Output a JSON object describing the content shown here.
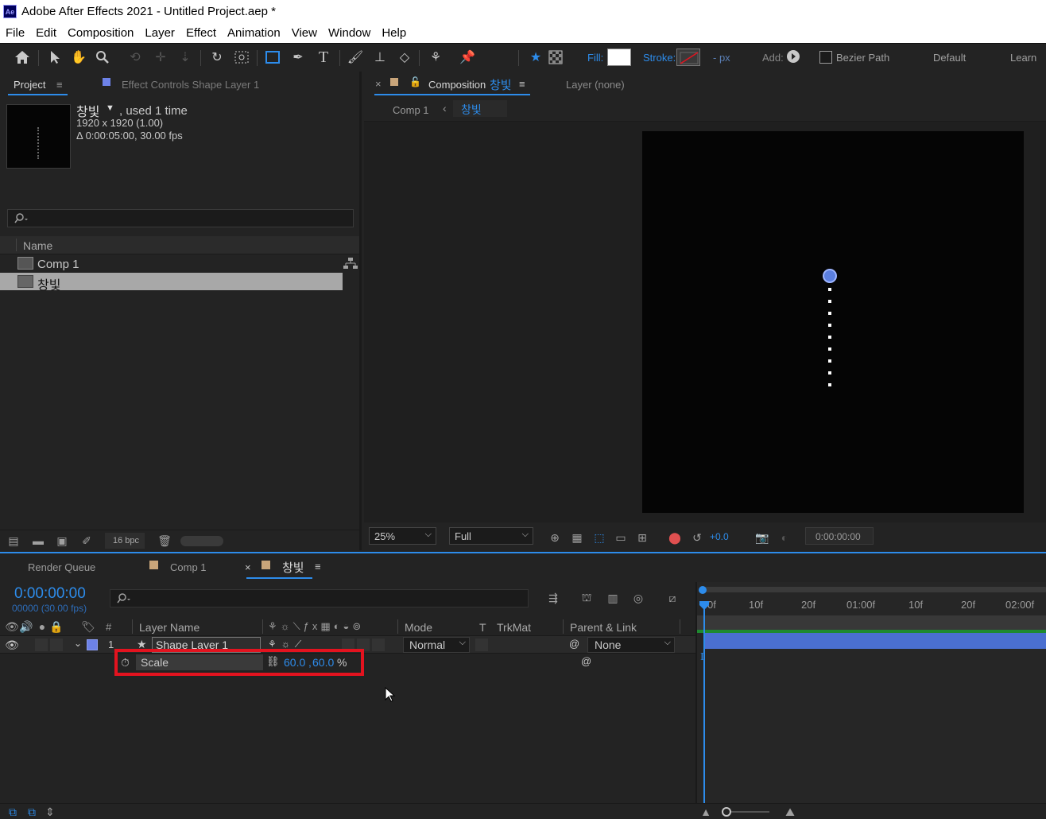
{
  "window": {
    "app_icon": "Ae",
    "title": "Adobe After Effects 2021 - Untitled Project.aep *"
  },
  "menu": [
    "File",
    "Edit",
    "Composition",
    "Layer",
    "Effect",
    "Animation",
    "View",
    "Window",
    "Help"
  ],
  "toolbar": {
    "fill_label": "Fill:",
    "stroke_label": "Stroke:",
    "stroke_width": "- px",
    "add_label": "Add:",
    "bezier_label": "Bezier Path",
    "workspace_default": "Default",
    "workspace_learn": "Learn",
    "fill_color": "#ffffff",
    "accent": "#2d8ceb"
  },
  "project": {
    "tab_project": "Project",
    "tab_effect_controls": "Effect Controls Shape Layer 1",
    "item_name": "창빛",
    "item_used": ", used 1 time",
    "item_dims": "1920 x 1920 (1.00)",
    "item_duration": "Δ 0:00:05:00, 30.00 fps",
    "search_placeholder": "",
    "col_name": "Name",
    "items": [
      "Comp 1",
      "창빛"
    ],
    "bpc": "16 bpc"
  },
  "viewer": {
    "tab_composition": "Composition",
    "comp_name": "창빛",
    "tab_layer": "Layer (none)",
    "breadcrumb_parent": "Comp 1",
    "breadcrumb_current": "창빛",
    "zoom": "25%",
    "resolution": "Full",
    "exposure": "+0.0",
    "timecode": "0:00:00:00"
  },
  "timeline": {
    "tab_render_queue": "Render Queue",
    "tab_comp1": "Comp 1",
    "tab_active": "창빛",
    "timecode": "0:00:00:00",
    "frames_fps": "00000 (30.00 fps)",
    "col_hash": "#",
    "col_layer_name": "Layer Name",
    "col_mode": "Mode",
    "col_t": "T",
    "col_trkmat": "TrkMat",
    "col_parent": "Parent & Link",
    "layer_index": "1",
    "layer_name": "Shape Layer 1",
    "layer_mode": "Normal",
    "layer_parent": "None",
    "prop_name": "Scale",
    "prop_value_x": "60.0",
    "prop_value_sep": ",",
    "prop_value_y": "60.0",
    "prop_unit": "%",
    "ruler": [
      "0f",
      "10f",
      "20f",
      "01:00f",
      "10f",
      "20f",
      "02:00f"
    ],
    "highlight_color": "#e3131f",
    "layer_bar_color": "#4a6fd0",
    "label_color": "#6d82e8"
  }
}
